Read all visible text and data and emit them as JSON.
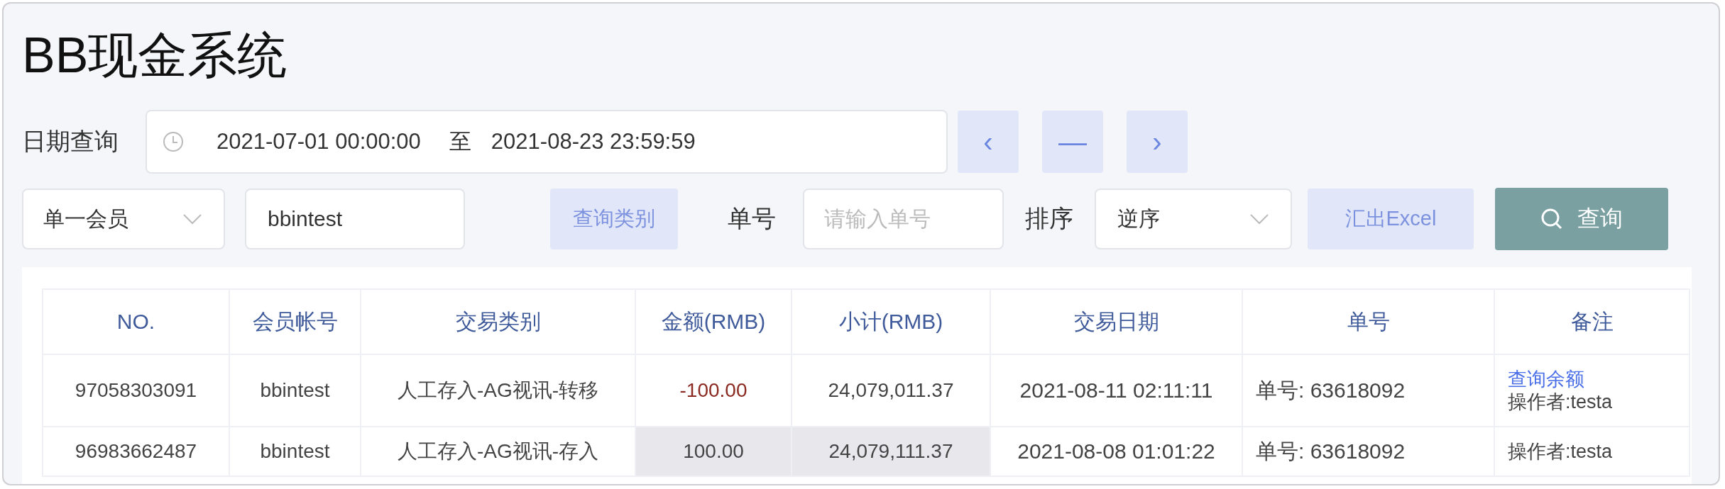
{
  "title": "BB现金系统",
  "date_query": {
    "label": "日期查询",
    "start": "2021-07-01 00:00:00",
    "separator": "至",
    "end": "2021-08-23 23:59:59",
    "buttons": [
      "‹",
      "—",
      "›"
    ]
  },
  "filters": {
    "member_select": {
      "value": "单一会员"
    },
    "member_input": {
      "value": "bbintest"
    },
    "category_button": "查询类别",
    "order_label": "单号",
    "order_input": {
      "placeholder": "请输入单号"
    },
    "sort_label": "排序",
    "sort_select": {
      "value": "逆序"
    },
    "export_button": "汇出Excel",
    "search_button": "查询"
  },
  "table": {
    "columns": [
      "NO.",
      "会员帐号",
      "交易类别",
      "金额(RMB)",
      "小计(RMB)",
      "交易日期",
      "单号",
      "备注"
    ],
    "rows": [
      {
        "no": "97058303091",
        "member": "bbintest",
        "type": "人工存入-AG视讯-转移",
        "amount": "-100.00",
        "negative": true,
        "subtotal": "24,079,011.37",
        "shaded": false,
        "date": "2021-08-11 02:11:11",
        "order": "单号: 63618092",
        "link": "查询余额",
        "operator": "操作者:testa"
      },
      {
        "no": "96983662487",
        "member": "bbintest",
        "type": "人工存入-AG视讯-存入",
        "amount": "100.00",
        "negative": false,
        "subtotal": "24,079,111.37",
        "shaded": true,
        "date": "2021-08-08 01:01:22",
        "order": "单号: 63618092",
        "operator": "操作者:testa"
      }
    ]
  }
}
